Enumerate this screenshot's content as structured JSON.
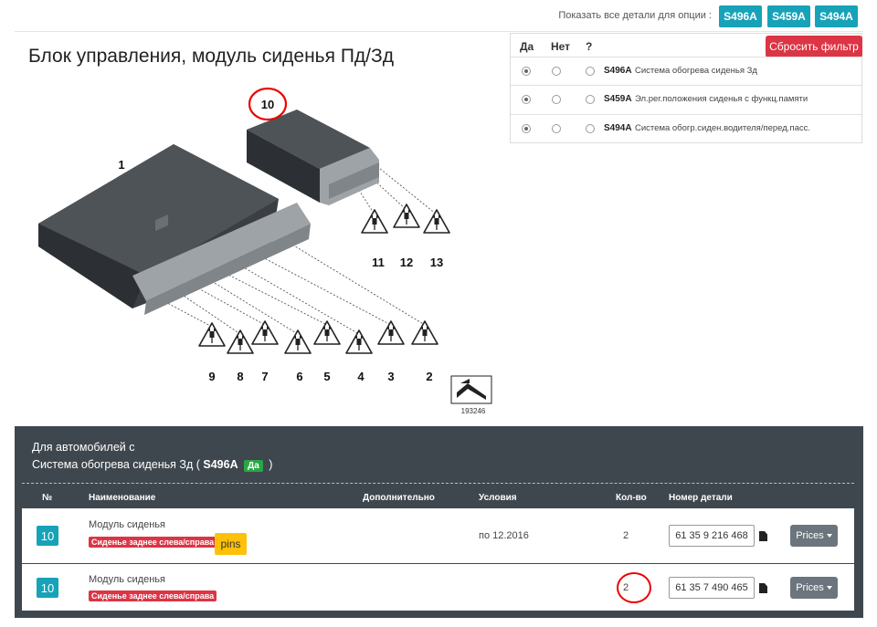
{
  "topbar": {
    "show_label": "Показать все детали для опции :",
    "options": [
      "S496A",
      "S459A",
      "S494A"
    ]
  },
  "page_title": "Блок управления, модуль сиденья Пд/Зд",
  "filter": {
    "col_yes": "Да",
    "col_no": "Нет",
    "col_q": "?",
    "reset_label": "Сбросить фильтр",
    "rows": [
      {
        "code": "S496A",
        "desc": "Система обогрева сиденья Зд"
      },
      {
        "code": "S459A",
        "desc": "Эл.рег.положения сиденья с функц.памяти"
      },
      {
        "code": "S494A",
        "desc": "Система обогр.сиден.водителя/перед.пасс."
      }
    ]
  },
  "diagram": {
    "callouts": [
      "1",
      "10",
      "11",
      "12",
      "13",
      "9",
      "8",
      "7",
      "6",
      "5",
      "4",
      "3",
      "2"
    ],
    "image_number": "193246",
    "icons": [
      "plug-warning-icon",
      "corner-arrow-icon"
    ]
  },
  "results": {
    "title_line1": "Для автомобилей с",
    "title_line2_text": "Система обогрева сиденья Зд (",
    "title_code": "S496A",
    "title_badge": "Да",
    "title_close": ")",
    "columns": {
      "num": "№",
      "name": "Наименование",
      "extra": "Дополнительно",
      "conditions": "Условия",
      "qty": "Кол-во",
      "part_number": "Номер детали"
    },
    "rows": [
      {
        "num": "10",
        "name": "Модуль сиденья",
        "tag": "Сиденье заднее слева/справа",
        "extra_badge": "pins",
        "conditions": "по 12.2016",
        "qty": "2",
        "part_number": "61 35 9 216 468",
        "prices_label": "Prices"
      },
      {
        "num": "10",
        "name": "Модуль сиденья",
        "tag": "Сиденье заднее слева/справа",
        "conditions": "",
        "qty": "2",
        "part_number": "61 35 7 490 465",
        "prices_label": "Prices"
      }
    ]
  },
  "colors": {
    "accent": "#17a2b8",
    "danger": "#dc3545",
    "success": "#28a745",
    "warning": "#ffc107",
    "dark_panel": "#3f474e",
    "highlight_circle": "#ee0000"
  }
}
